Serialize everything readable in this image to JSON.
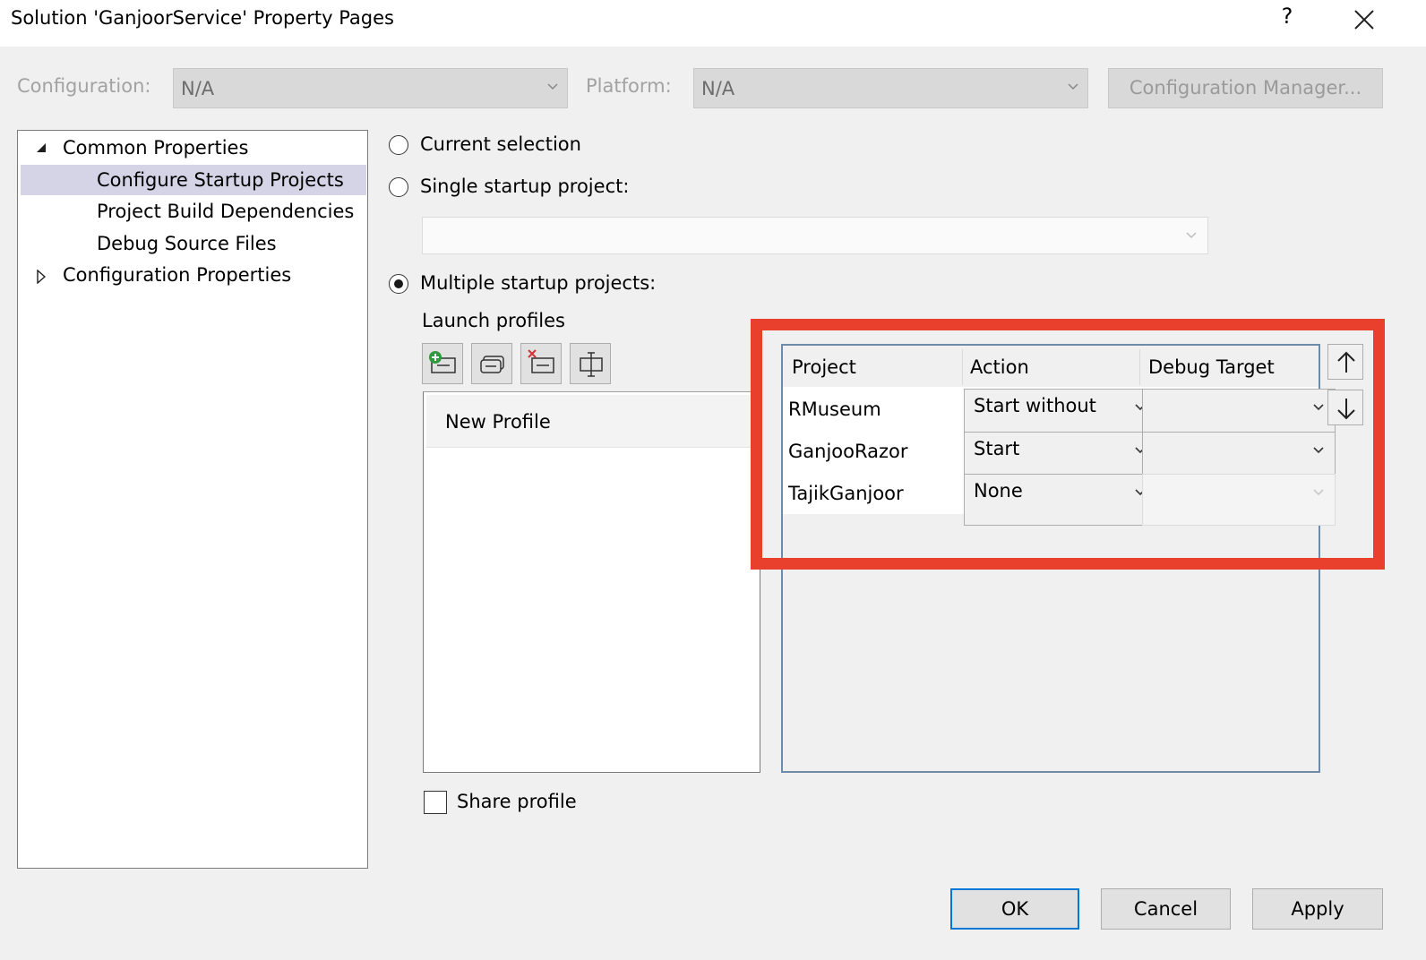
{
  "window": {
    "title": "Solution 'GanjoorService' Property Pages",
    "help_label": "?"
  },
  "config_row": {
    "configuration_label": "Configuration:",
    "configuration_value": "N/A",
    "platform_label": "Platform:",
    "platform_value": "N/A",
    "config_manager_label": "Configuration Manager..."
  },
  "tree": {
    "items": [
      {
        "label": "Common Properties",
        "expander": "expanded"
      },
      {
        "label": "Configure Startup Projects",
        "selected": true
      },
      {
        "label": "Project Build Dependencies"
      },
      {
        "label": "Debug Source Files"
      },
      {
        "label": "Configuration Properties",
        "expander": "collapsed"
      }
    ]
  },
  "startup": {
    "current_selection_label": "Current selection",
    "single_startup_label": "Single startup project:",
    "multiple_startup_label": "Multiple startup projects:",
    "selected_option": "multiple",
    "launch_profiles_label": "Launch profiles",
    "profiles": [
      "New Profile"
    ],
    "share_profile_label": "Share profile",
    "share_profile_checked": false
  },
  "grid": {
    "headers": [
      "Project",
      "Action",
      "Debug Target"
    ],
    "rows": [
      {
        "project": "RMuseum",
        "action": "Start without",
        "debug_target": ""
      },
      {
        "project": "GanjooRazor",
        "action": "Start",
        "debug_target": ""
      },
      {
        "project": "TajikGanjoor",
        "action": "None",
        "debug_target": ""
      }
    ]
  },
  "buttons": {
    "ok": "OK",
    "cancel": "Cancel",
    "apply": "Apply"
  },
  "colors": {
    "highlight": "#e8402c",
    "selection": "#d4d4e6",
    "grid_border": "#6f8ba8"
  }
}
